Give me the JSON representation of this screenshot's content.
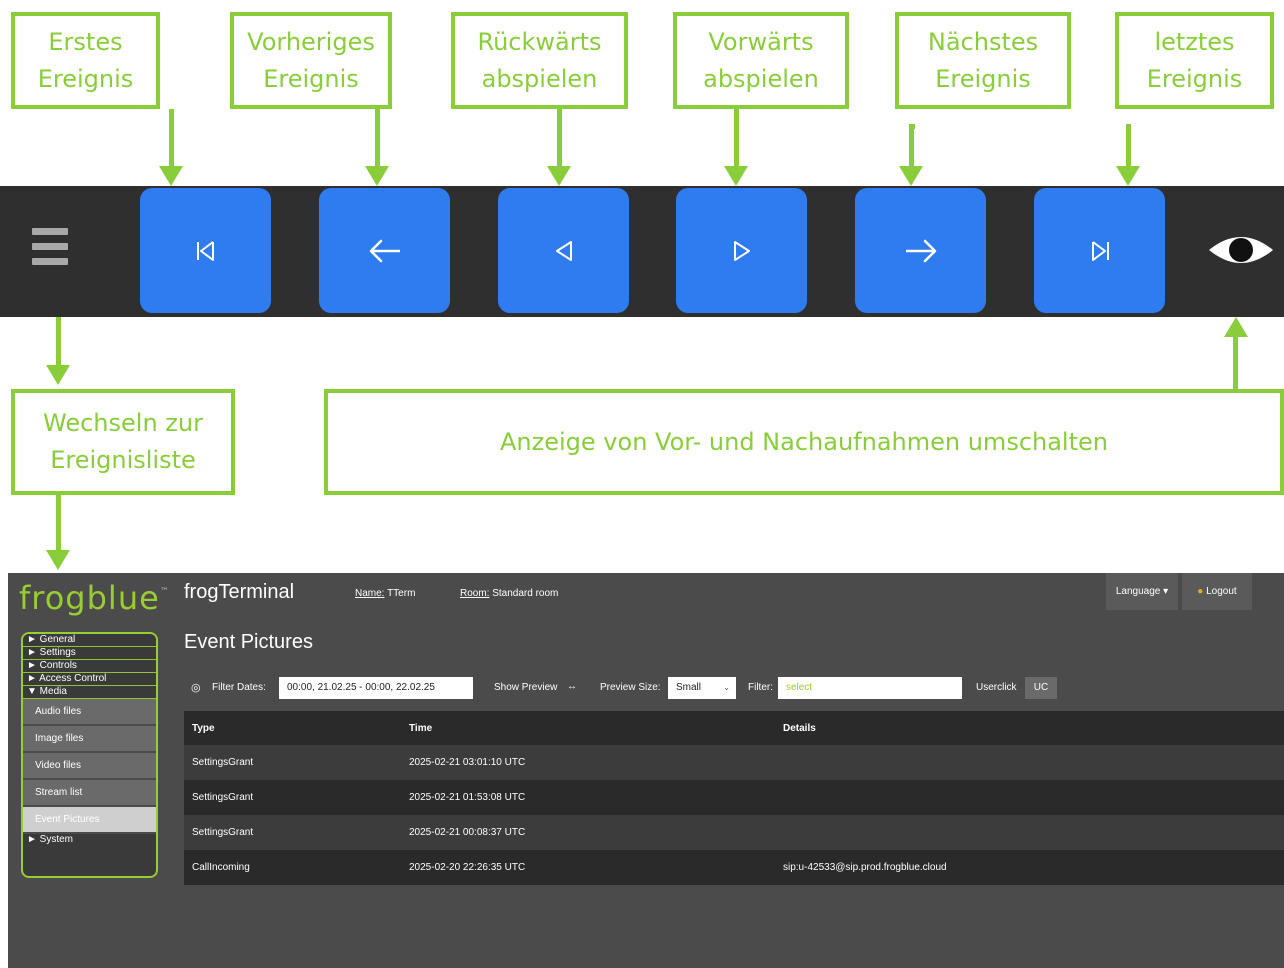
{
  "callouts": {
    "first": [
      "Erstes",
      "Ereignis"
    ],
    "prev": [
      "Vorheriges",
      "Ereignis"
    ],
    "back": [
      "Rückwärts",
      "abspielen"
    ],
    "fwd": [
      "Vorwärts",
      "abspielen"
    ],
    "next": [
      "Nächstes",
      "Ereignis"
    ],
    "last": [
      "letztes",
      "Ereignis"
    ],
    "list": [
      "Wechseln zur",
      "Ereignisliste"
    ],
    "toggle": "Anzeige von Vor- und Nachaufnahmen umschalten"
  },
  "toolbar": {
    "icons": [
      "menu-icon",
      "skip-first-icon",
      "arrow-left-icon",
      "play-backward-icon",
      "play-forward-icon",
      "arrow-right-icon",
      "skip-last-icon",
      "eye-icon"
    ],
    "button_color": "#2f7bf0",
    "background": "#2f2f30"
  },
  "app": {
    "logo": "frogblue",
    "logo_tm": "™",
    "title": "frogTerminal",
    "name_label": "Name:",
    "name_value": "TTerm",
    "room_label": "Room:",
    "room_value": "Standard room",
    "language_btn": "Language ▾",
    "logout_btn": "Logout",
    "nav": {
      "general": "► General",
      "settings": "► Settings",
      "controls": "► Controls",
      "access": "► Access Control",
      "media": "▼ Media",
      "sub": [
        "Audio files",
        "Image files",
        "Video files",
        "Stream list",
        "Event Pictures"
      ],
      "system": "► System"
    },
    "page_title": "Event Pictures",
    "filters": {
      "filter_dates_label": "Filter Dates:",
      "filter_dates_value": "00:00, 21.02.25 - 00:00, 22.02.25",
      "show_preview": "Show Preview",
      "preview_size_label": "Preview Size:",
      "preview_size_value": "Small",
      "filter_label": "Filter:",
      "filter_placeholder": "select",
      "userclick": "Userclick",
      "uc": "UC"
    },
    "table": {
      "headers": [
        "Type",
        "Time",
        "Details"
      ],
      "rows": [
        [
          "SettingsGrant",
          "2025-02-21 03:01:10 UTC",
          ""
        ],
        [
          "SettingsGrant",
          "2025-02-21 01:53:08 UTC",
          ""
        ],
        [
          "SettingsGrant",
          "2025-02-21 00:08:37 UTC",
          ""
        ],
        [
          "CallIncoming",
          "2025-02-20 22:26:35 UTC",
          "sip:u-42533@sip.prod.frogblue.cloud"
        ]
      ]
    }
  }
}
